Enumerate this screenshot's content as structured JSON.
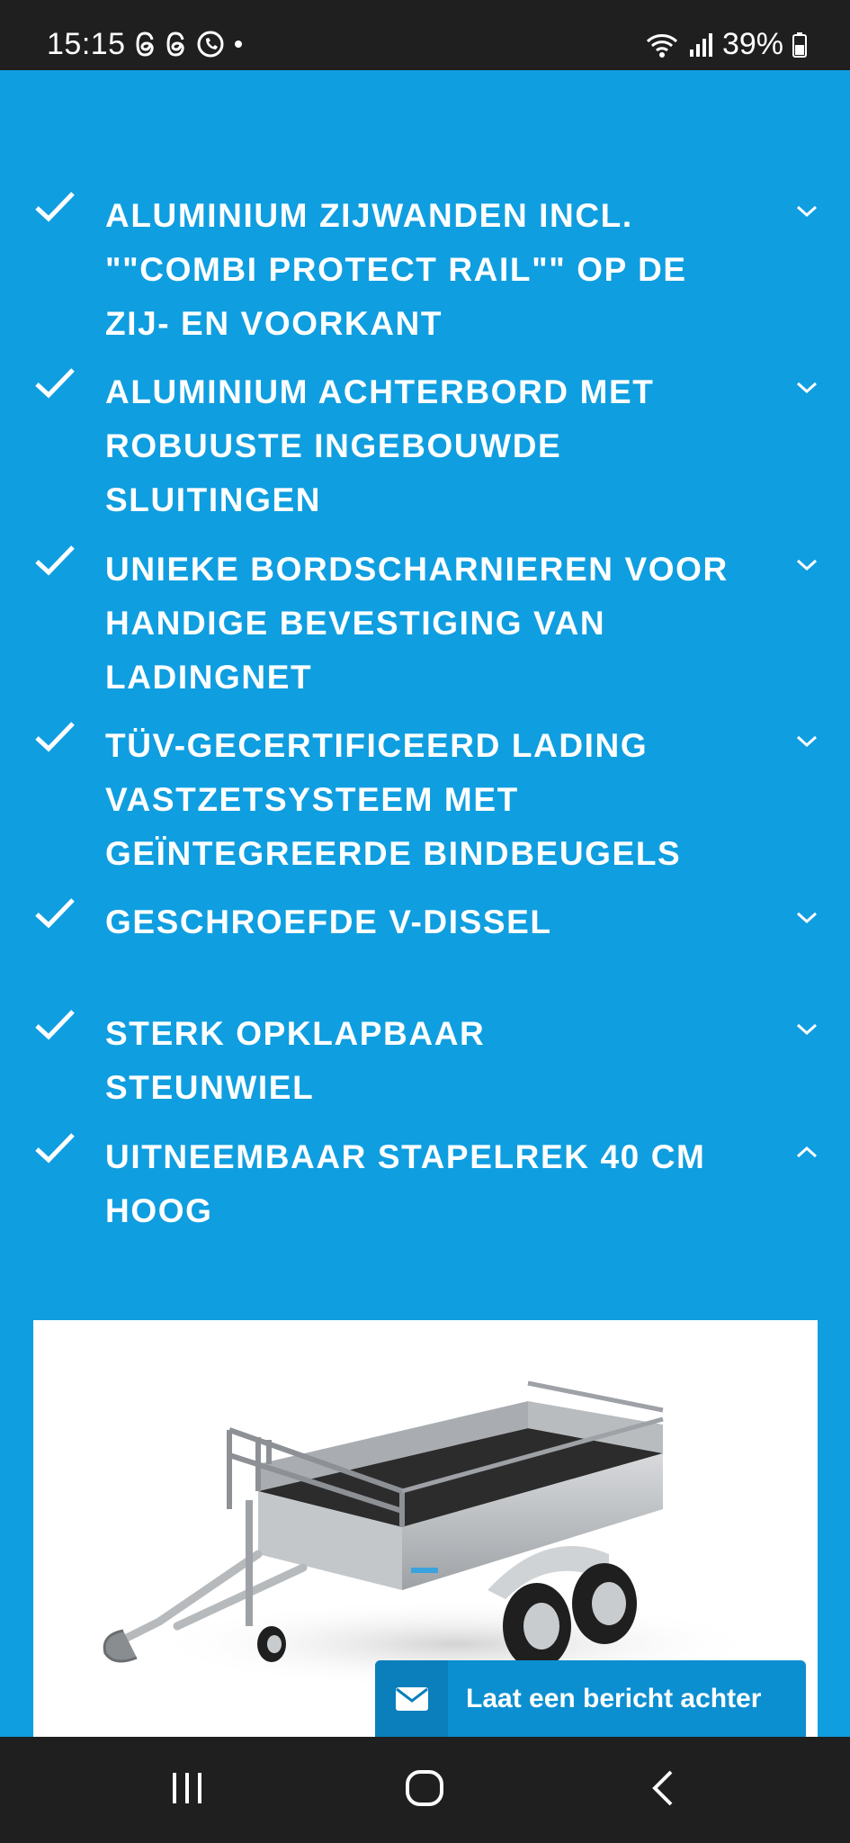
{
  "status_bar": {
    "time": "15:15",
    "app_icons": [
      "threads-icon",
      "threads-icon",
      "whatsapp-icon",
      "dot-icon"
    ],
    "battery": "39%"
  },
  "accordion": [
    {
      "title": "ALUMINIUM ZIJWANDEN INCL. \"\"COMBI PROTECT RAIL\"\" OP DE ZIJ- EN VOORKANT",
      "expanded": false
    },
    {
      "title": "ALUMINIUM ACHTERBORD MET ROBUUSTE INGEBOUWDE SLUITINGEN",
      "expanded": false
    },
    {
      "title": "UNIEKE BORDSCHARNIEREN VOOR HANDIGE BEVESTIGING VAN LADINGNET",
      "expanded": false
    },
    {
      "title": "TÜV-GECERTIFICEERD LADING VASTZETSYSTEEM MET GEÏNTEGREERDE BINDBEUGELS",
      "expanded": false
    },
    {
      "title": "GESCHROEFDE V-DISSEL",
      "expanded": false
    },
    {
      "title": "STERK OPKLAPBAAR STEUNWIEL",
      "expanded": false
    },
    {
      "title": "UITNEEMBAAR STAPELREK 40 CM HOOG",
      "expanded": true
    }
  ],
  "message_button": {
    "label": "Laat een bericht achter",
    "icon": "envelope-icon"
  },
  "nav_bar": {
    "buttons": [
      "recents-icon",
      "home-icon",
      "back-icon"
    ]
  },
  "colors": {
    "background": "#0f9ee0",
    "text": "#ffffff",
    "status_bar": "#1f1f1f",
    "message_button": "#0c8fd0"
  }
}
